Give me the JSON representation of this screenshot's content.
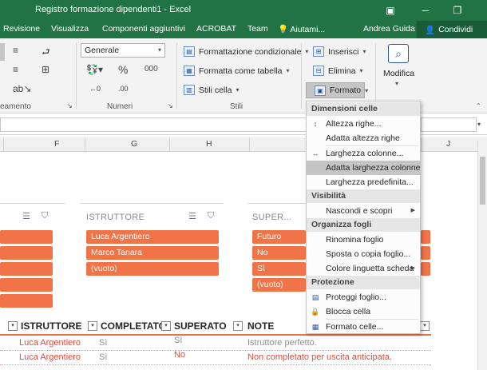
{
  "window": {
    "title": "Registro formazione dipendenti1 - Excel",
    "controls": [
      "▣",
      "─",
      "❐"
    ]
  },
  "tabs": [
    "Revisione",
    "Visualizza",
    "Componenti aggiuntivi",
    "ACROBAT",
    "Team",
    "Aiutami...",
    "Andrea Guida"
  ],
  "share_label": "Condividi",
  "ribbon": {
    "number_format_value": "Generale",
    "number_symbols": [
      "%",
      "000",
      "←0",
      ".00"
    ],
    "styles_items": [
      "Formattazione condizionale",
      "Formatta come tabella",
      "Stili cella"
    ],
    "cells_items": [
      "Inserisci",
      "Elimina",
      "Formato"
    ],
    "edit_label": "Modifica",
    "group_labels": [
      "eamento",
      "Numeri",
      "Stili"
    ]
  },
  "columns": [
    "F",
    "G",
    "H",
    "J"
  ],
  "slicers": {
    "istruttore": {
      "title": "ISTRUTTORE",
      "items": [
        "Luca Argentiero",
        "Marco Tanara",
        "(vuoto)"
      ]
    },
    "superato": {
      "title": "SUPER...",
      "items": [
        "Futuro",
        "No",
        "Sì",
        "(vuoto)"
      ]
    }
  },
  "table": {
    "headers": [
      "ISTRUTTORE",
      "COMPLETATO",
      "SUPERATO",
      "NOTE"
    ],
    "rows": [
      [
        "Luca Argentiero",
        "Sì",
        "Sì",
        "Istruttore perfetto."
      ],
      [
        "Luca Argentiero",
        "Sì",
        "No",
        "Non completato per uscita anticipata."
      ]
    ]
  },
  "menu": {
    "sections": [
      {
        "title": "Dimensioni celle",
        "items": [
          "Altezza righe...",
          "Adatta altezza righe",
          "Larghezza colonne...",
          "Adatta larghezza colonne",
          "Larghezza predefinita..."
        ]
      },
      {
        "title": "Visibilità",
        "items": [
          "Nascondi e scopri"
        ]
      },
      {
        "title": "Organizza fogli",
        "items": [
          "Rinomina foglio",
          "Sposta o copia foglio...",
          "Colore linguetta scheda"
        ]
      },
      {
        "title": "Protezione",
        "items": [
          "Proteggi foglio...",
          "Blocca cella",
          "Formato celle..."
        ]
      }
    ]
  },
  "icons": {
    "search": "search-icon",
    "share": "person-icon"
  },
  "colors": {
    "excel_green": "#217346",
    "slicer_orange": "#f07448",
    "table_red": "#e24c3c",
    "menu_highlight": "#c5c5c5"
  }
}
